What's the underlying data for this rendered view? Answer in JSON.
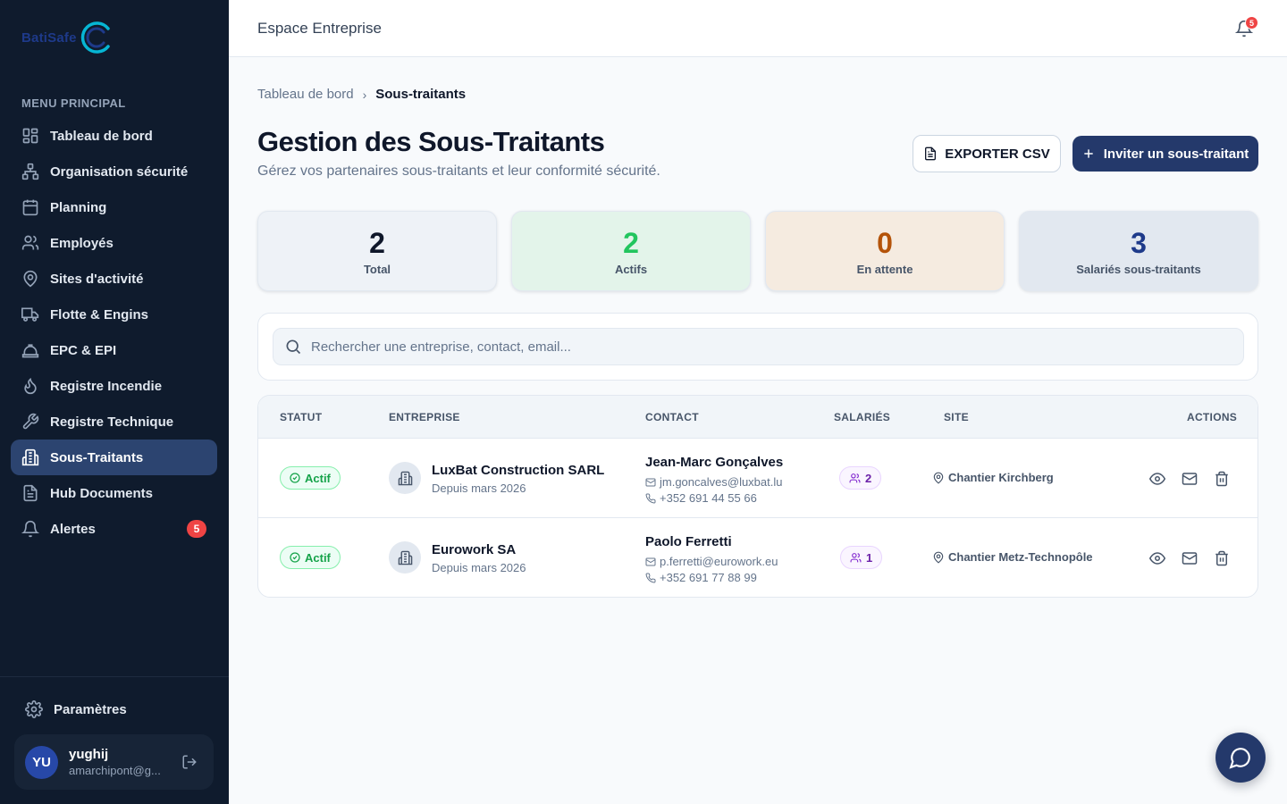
{
  "brand": {
    "name": "BatiSafe"
  },
  "sidebar": {
    "heading": "MENU PRINCIPAL",
    "items": [
      {
        "label": "Tableau de bord",
        "icon": "dashboard-icon"
      },
      {
        "label": "Organisation sécurité",
        "icon": "org-chart-icon"
      },
      {
        "label": "Planning",
        "icon": "calendar-icon"
      },
      {
        "label": "Employés",
        "icon": "users-icon"
      },
      {
        "label": "Sites d'activité",
        "icon": "map-pin-icon"
      },
      {
        "label": "Flotte & Engins",
        "icon": "truck-icon"
      },
      {
        "label": "EPC & EPI",
        "icon": "hard-hat-icon"
      },
      {
        "label": "Registre Incendie",
        "icon": "flame-icon"
      },
      {
        "label": "Registre Technique",
        "icon": "wrench-icon"
      },
      {
        "label": "Sous-Traitants",
        "icon": "building-icon",
        "active": true
      },
      {
        "label": "Hub Documents",
        "icon": "document-icon"
      },
      {
        "label": "Alertes",
        "icon": "bell-icon",
        "badge": "5"
      }
    ],
    "settings_label": "Paramètres",
    "user": {
      "initials": "YU",
      "name": "yughij",
      "email": "amarchipont@g..."
    }
  },
  "topbar": {
    "title": "Espace Entreprise",
    "notifications": "5"
  },
  "breadcrumb": {
    "home": "Tableau de bord",
    "separator": "›",
    "current": "Sous-traitants"
  },
  "page": {
    "title": "Gestion des Sous-Traitants",
    "subtitle": "Gérez vos partenaires sous-traitants et leur conformité sécurité.",
    "export_label": "EXPORTER CSV",
    "invite_label": "Inviter un sous-traitant"
  },
  "stats": [
    {
      "value": "2",
      "label": "Total",
      "color": "#0f172a",
      "bg": "#eef2f7"
    },
    {
      "value": "2",
      "label": "Actifs",
      "color": "#22c55e",
      "bg": "#e3f4ea"
    },
    {
      "value": "0",
      "label": "En attente",
      "color": "#b45309",
      "bg": "#f5ebe0"
    },
    {
      "value": "3",
      "label": "Salariés sous-traitants",
      "color": "#1e3a8a",
      "bg": "#e2e8f0"
    }
  ],
  "search": {
    "placeholder": "Rechercher une entreprise, contact, email..."
  },
  "table": {
    "headers": {
      "status": "STATUT",
      "company": "ENTREPRISE",
      "contact": "CONTACT",
      "employees": "SALARIÉS",
      "site": "SITE",
      "actions": "ACTIONS"
    },
    "rows": [
      {
        "status": "Actif",
        "company": "LuxBat Construction SARL",
        "since": "Depuis mars 2026",
        "contact_name": "Jean-Marc Gonçalves",
        "email": "jm.goncalves@luxbat.lu",
        "phone": "+352 691 44 55 66",
        "employees": "2",
        "site": "Chantier Kirchberg"
      },
      {
        "status": "Actif",
        "company": "Eurowork SA",
        "since": "Depuis mars 2026",
        "contact_name": "Paolo Ferretti",
        "email": "p.ferretti@eurowork.eu",
        "phone": "+352 691 77 88 99",
        "employees": "1",
        "site": "Chantier Metz-Technopôle"
      }
    ]
  }
}
